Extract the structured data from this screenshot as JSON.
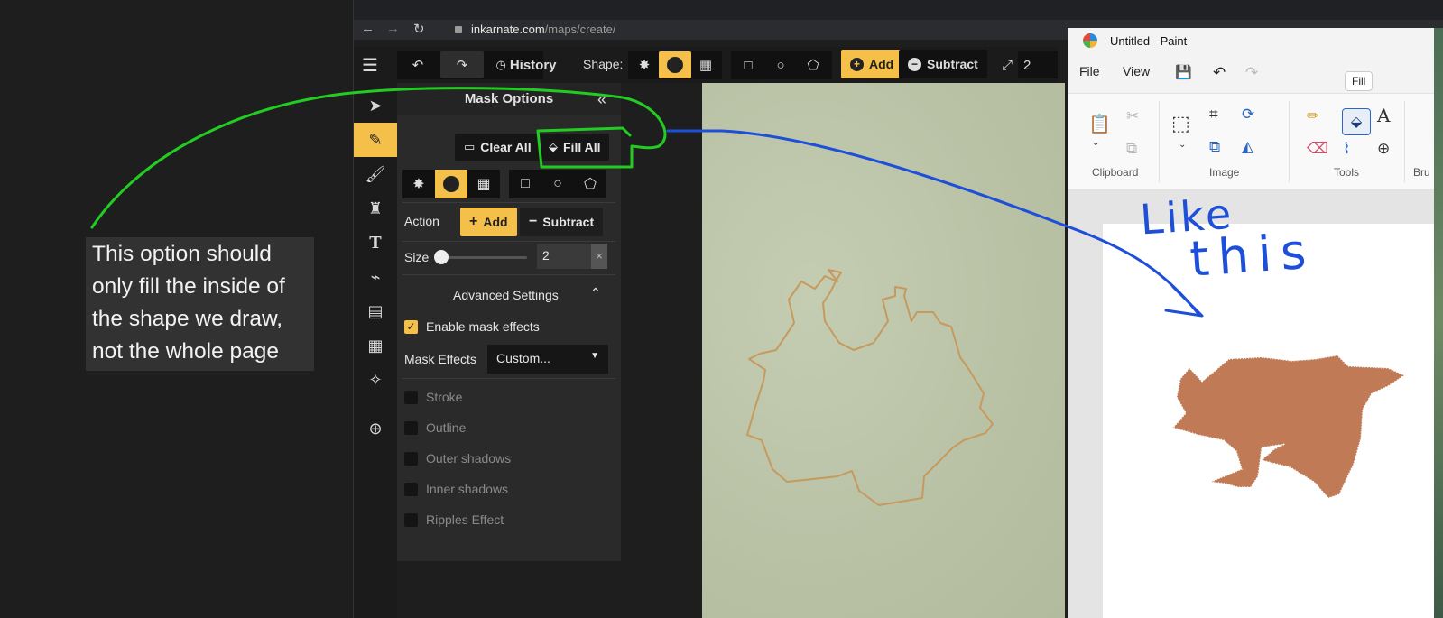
{
  "annotation": {
    "lines": [
      "This option should",
      "only fill the inside of",
      "the shape we draw,",
      "not the whole page"
    ],
    "handwritten": [
      "Like",
      "this"
    ],
    "highlight_color": "#22cc22",
    "arrow_color": "#1e4fd8"
  },
  "browser": {
    "url_host": "inkarnate.com",
    "url_path": "/maps/create/",
    "nav": {
      "back": "←",
      "forward": "→",
      "reload": "↻"
    }
  },
  "toolbar": {
    "history_label": "History",
    "shape_label": "Shape:",
    "add_label": "Add",
    "subtract_label": "Subtract",
    "size_value": "2"
  },
  "mask_panel": {
    "title": "Mask Options",
    "clear_all": "Clear All",
    "fill_all": "Fill All",
    "action_label": "Action",
    "add": "Add",
    "subtract": "Subtract",
    "size_label": "Size",
    "size_value": "2",
    "size_slider": 0.0,
    "clear_symbol": "×",
    "advanced": "Advanced Settings",
    "enable_mask_effects": "Enable mask effects",
    "mask_effects_label": "Mask Effects",
    "mask_effects_value": "Custom...",
    "effects": [
      "Stroke",
      "Outline",
      "Outer shadows",
      "Inner shadows",
      "Ripples Effect"
    ]
  },
  "paint": {
    "title": "Untitled - Paint",
    "menu": [
      "File",
      "View"
    ],
    "tooltip": "Fill",
    "groups": [
      "Clipboard",
      "Image",
      "Tools",
      "Bru"
    ],
    "fill_color": "#c07a55"
  },
  "colors": {
    "accent": "#f5c04a",
    "panel": "#2a2a2a",
    "canvas": "#bcc4a9"
  }
}
